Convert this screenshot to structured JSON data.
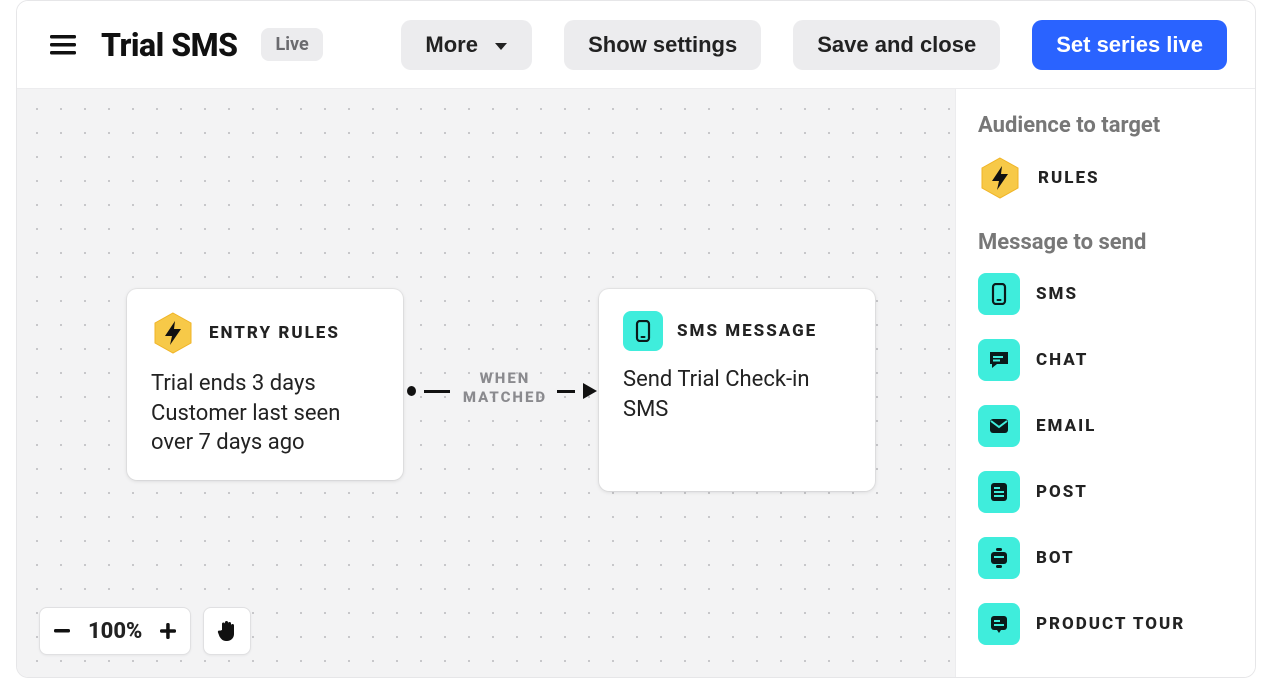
{
  "header": {
    "title": "Trial SMS",
    "status_badge": "Live",
    "more_label": "More",
    "show_settings_label": "Show settings",
    "save_close_label": "Save and close",
    "set_live_label": "Set series live"
  },
  "canvas": {
    "entry_card": {
      "title": "ENTRY RULES",
      "line1": "Trial ends 3 days",
      "line2": "Customer last seen over 7 days ago"
    },
    "sms_card": {
      "title": "SMS MESSAGE",
      "body": "Send Trial Check-in SMS"
    },
    "connector_label_line1": "WHEN",
    "connector_label_line2": "MATCHED"
  },
  "zoom": {
    "level": "100%"
  },
  "sidebar": {
    "audience_heading": "Audience to target",
    "rules_label": "RULES",
    "message_heading": "Message to send",
    "items": [
      {
        "label": "SMS",
        "icon": "sms-icon"
      },
      {
        "label": "CHAT",
        "icon": "chat-icon"
      },
      {
        "label": "EMAIL",
        "icon": "email-icon"
      },
      {
        "label": "POST",
        "icon": "post-icon"
      },
      {
        "label": "BOT",
        "icon": "bot-icon"
      },
      {
        "label": "PRODUCT TOUR",
        "icon": "product-tour-icon"
      }
    ]
  }
}
